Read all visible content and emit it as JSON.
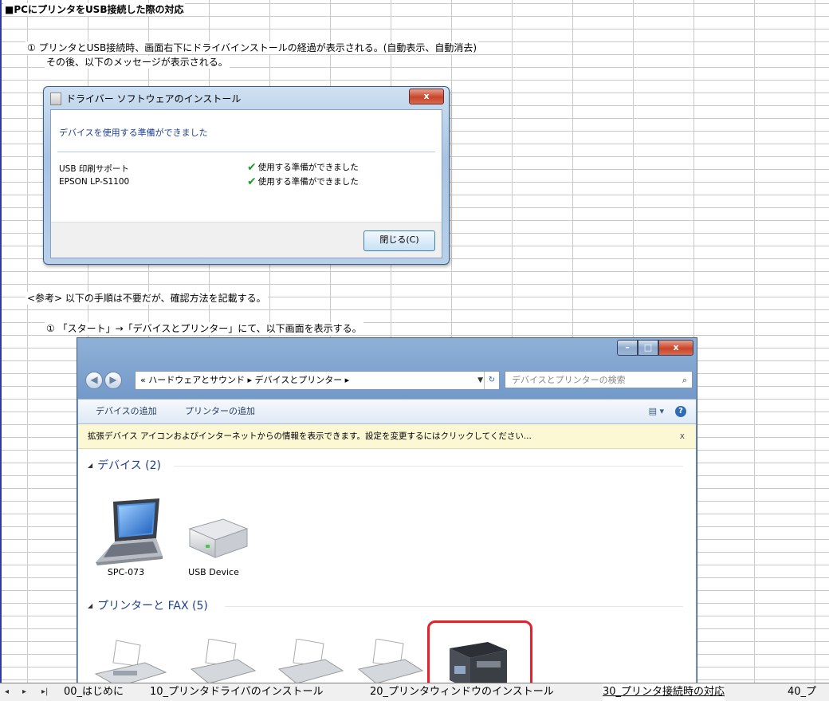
{
  "sheet": {
    "title": "■PCにプリンタをUSB接続した際の対応",
    "step1_line1": "① プリンタとUSB接続時、画面右下にドライバインストールの経過が表示される。(自動表示、自動消去)",
    "step1_line2": "その後、以下のメッセージが表示される。",
    "note": "<参考>  以下の手順は不要だが、確認方法を記載する。",
    "step2": "① 「スタート」→「デバイスとプリンター」にて、以下画面を表示する。"
  },
  "driver_dialog": {
    "title": "ドライバー ソフトウェアのインストール",
    "close_glyph": "x",
    "heading": "デバイスを使用する準備ができました",
    "items": [
      {
        "name": "USB 印刷サポート",
        "status": "使用する準備ができました"
      },
      {
        "name": "EPSON LP-S1100",
        "status": "使用する準備ができました"
      }
    ],
    "close_button": "閉じる(C)"
  },
  "devices_window": {
    "controls": {
      "min": "–",
      "max": "□",
      "close": "x"
    },
    "breadcrumb": "« ハードウェアとサウンド ▸ デバイスとプリンター ▸",
    "search_placeholder": "デバイスとプリンターの検索",
    "toolbar": {
      "add_device": "デバイスの追加",
      "add_printer": "プリンターの追加"
    },
    "infobar": "拡張デバイス アイコンおよびインターネットからの情報を表示できます。設定を変更するにはクリックしてください...",
    "infobar_close": "x",
    "groups": {
      "devices": "デバイス (2)",
      "printers": "プリンターと FAX (5)"
    },
    "devices": [
      {
        "label": "SPC-073",
        "icon": "laptop-icon"
      },
      {
        "label": "USB Device",
        "icon": "drive-icon"
      }
    ],
    "printers": [
      {
        "icon": "fax-icon"
      },
      {
        "icon": "printer-icon"
      },
      {
        "icon": "printer-icon"
      },
      {
        "icon": "printer-icon"
      },
      {
        "icon": "multifunction-printer-icon"
      }
    ]
  },
  "sheet_tabs": {
    "nav": [
      "◂",
      "▸",
      "▸|"
    ],
    "tabs": [
      {
        "label": "00_はじめに"
      },
      {
        "label": "10_プリンタドライバのインストール"
      },
      {
        "label": "20_プリンタウィンドウのインストール"
      },
      {
        "label": "30_プリンタ接続時の対応",
        "active": true
      },
      {
        "label": "40_プ"
      }
    ]
  }
}
